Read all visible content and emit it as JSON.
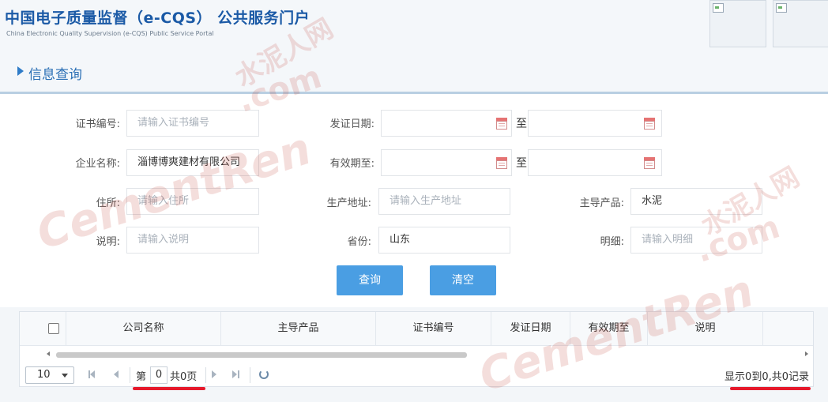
{
  "header": {
    "title": "中国电子质量监督（e-CQS） 公共服务门户",
    "subtitle": "China Electronic Quality Supervision (e-CQS) Public Service Portal"
  },
  "section": {
    "title": "信息查询"
  },
  "form": {
    "cert_no": {
      "label": "证书编号:",
      "placeholder": "请输入证书编号",
      "value": ""
    },
    "issue_date": {
      "label": "发证日期:",
      "to": "至"
    },
    "company": {
      "label": "企业名称:",
      "value": "淄博博爽建材有限公司"
    },
    "valid_until": {
      "label": "有效期至:",
      "to": "至"
    },
    "address": {
      "label": "住所:",
      "placeholder": "请输入住所"
    },
    "prod_address": {
      "label": "生产地址:",
      "placeholder": "请输入生产地址"
    },
    "main_product": {
      "label": "主导产品:",
      "value": "水泥"
    },
    "desc": {
      "label": "说明:",
      "placeholder": "请输入说明"
    },
    "province": {
      "label": "省份:",
      "value": "山东"
    },
    "detail": {
      "label": "明细:",
      "placeholder": "请输入明细"
    }
  },
  "buttons": {
    "search": "查询",
    "clear": "清空"
  },
  "table": {
    "columns": [
      "公司名称",
      "主导产品",
      "证书编号",
      "发证日期",
      "有效期至",
      "说明"
    ]
  },
  "pager": {
    "page_size": "10",
    "page_prefix": "第",
    "page_value": "0",
    "page_suffix": "共0页",
    "summary": "显示0到0,共0记录"
  },
  "watermark": {
    "text_cn": "水泥人网",
    "text_en": "CementRen",
    "text_com": ".com"
  },
  "colors": {
    "accent": "#4a9ee3",
    "title": "#1b5aa6",
    "highlight": "#e6192b"
  }
}
